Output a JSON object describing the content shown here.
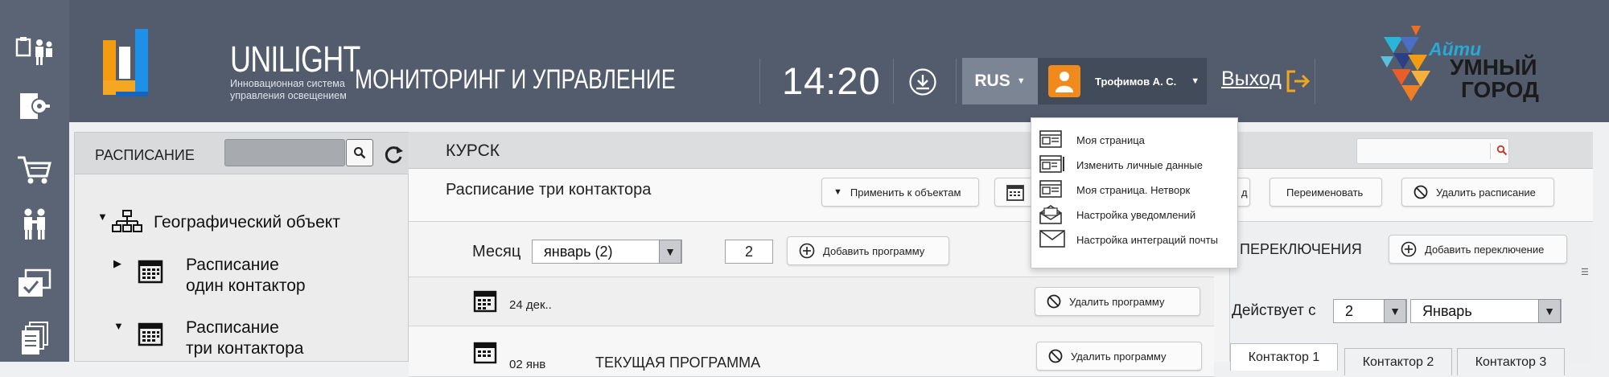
{
  "colors": {
    "header_bg": "#525c6d",
    "rail_bg": "#5a6475",
    "accent_orange": "#f08a1c",
    "accent_blue": "#1e90e8"
  },
  "brand": {
    "name": "UNILIGHT",
    "tagline": "Инновационная система управления освещением"
  },
  "header": {
    "title": "МОНИТОРИНГ И УПРАВЛЕНИЕ",
    "time": "14:20",
    "language": "RUS",
    "user_name": "Трофимов А. С.",
    "logout_label": "Выход",
    "partner_logo": {
      "line1": "Айти",
      "line2": "УМНЫЙ",
      "line3": "ГОРОД"
    }
  },
  "user_menu": {
    "items": [
      {
        "label": "Моя страница",
        "icon": "profile-card-icon"
      },
      {
        "label": "Изменить личные данные",
        "icon": "edit-card-icon"
      },
      {
        "label": "Моя страница. Нетворк",
        "icon": "network-card-icon"
      },
      {
        "label": "Настройка уведомлений",
        "icon": "open-envelope-icon"
      },
      {
        "label": "Настройка интеграций почты",
        "icon": "envelope-icon"
      }
    ]
  },
  "left_panel": {
    "title": "РАСПИСАНИЕ",
    "search_placeholder": "",
    "tree": [
      {
        "label": "Географический объект",
        "icon": "hierarchy-icon",
        "expanded": true
      },
      {
        "label_line1": "Расписание",
        "label_line2": "один контактор",
        "icon": "calendar-icon",
        "expanded": false
      },
      {
        "label_line1": "Расписание",
        "label_line2": "три контактора",
        "icon": "calendar-icon",
        "expanded": true
      }
    ]
  },
  "main": {
    "location": "КУРСК",
    "schedule_title": "Расписание три контактора",
    "buttons": {
      "apply": "Применить к объектам",
      "copy_partial": "д",
      "rename": "Переименовать",
      "delete_schedule": "Удалить расписание",
      "add_program": "Добавить программу",
      "add_switch": "Добавить переключение",
      "delete_program": "Удалить программу"
    },
    "month_label": "Месяц",
    "month_value": "январь (2)",
    "month_number": "2",
    "rows": [
      {
        "date": "24 дек..",
        "name": ""
      },
      {
        "date": "02 янв",
        "name": "ТЕКУЩАЯ ПРОГРАММА"
      }
    ]
  },
  "switches": {
    "title_partial": "ПЕРЕКЛЮЧЕНИЯ",
    "effective_label": "Действует с",
    "day_value": "2",
    "month_value": "Январь",
    "tabs": [
      "Контактор 1",
      "Контактор 2",
      "Контактор 3"
    ]
  }
}
